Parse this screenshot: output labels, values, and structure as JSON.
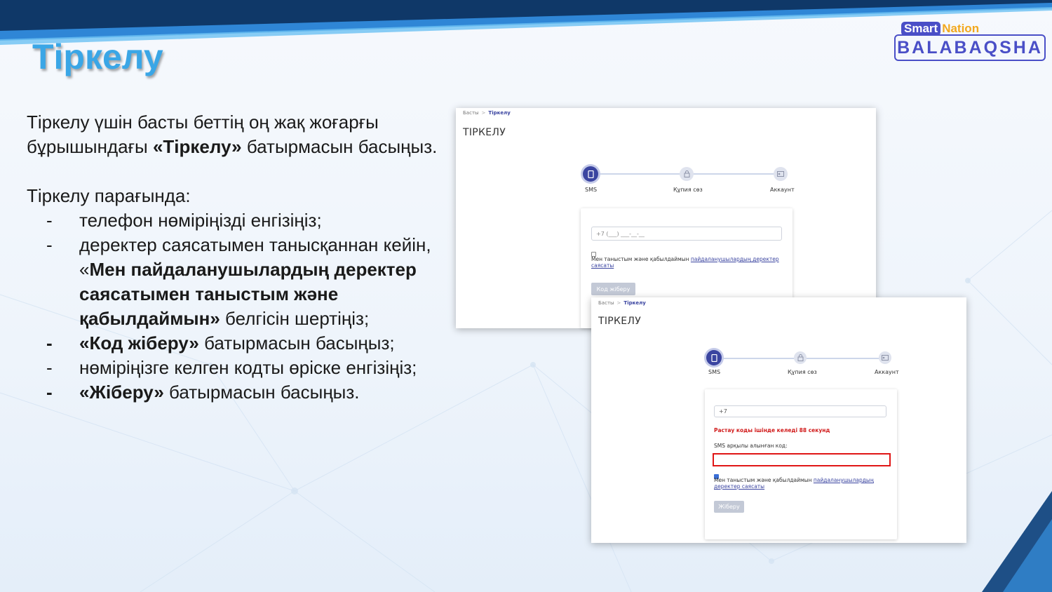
{
  "slide": {
    "title": "Тіркелу",
    "logo": {
      "smart": "Smart",
      "nation": "Nation",
      "brand": "BALABAQSHA"
    },
    "intro": {
      "part1": "Тіркелу үшін басты беттің оң жақ жоғарғы бұрышындағы ",
      "bold": "«Тіркелу»",
      "part2": " батырмасын басыңыз."
    },
    "list_heading": "Тіркелу парағында:",
    "items": [
      {
        "dash": "-",
        "text": "телефон нөміріңізді енгізіңіз;"
      },
      {
        "dash": "-",
        "pre": "деректер саясатымен танысқаннан кейін, «",
        "bold": "Мен пайдаланушылардың деректер саясатымен таныстым және қабылдаймын»",
        "post": " белгісін шертіңіз;"
      },
      {
        "dash": "-",
        "bold": "«Код жіберу»",
        "post": " батырмасын басыңыз;"
      },
      {
        "dash": "-",
        "text": "нөміріңізге келген кодты өріске енгізіңіз;"
      },
      {
        "dash": "-",
        "bold": "«Жіберу»",
        "post": " батырмасын басыңыз."
      }
    ]
  },
  "screen1": {
    "breadcrumb": {
      "home": "Басты",
      "sep": ">",
      "current": "Тіркелу"
    },
    "page_title": "ТІРКЕЛУ",
    "steps": [
      {
        "label": "SMS",
        "icon": "phone-icon",
        "active": true
      },
      {
        "label": "Құпия сөз",
        "icon": "lock-icon",
        "active": false
      },
      {
        "label": "Аккаунт",
        "icon": "id-card-icon",
        "active": false
      }
    ],
    "phone_placeholder": "+7 (___) ___-__-__",
    "consent_text": "Мен таныстым және қабылдаймын ",
    "consent_link": "пайдаланушылардың деректер саясаты",
    "submit_label": "Код жіберу"
  },
  "screen2": {
    "breadcrumb": {
      "home": "Басты",
      "sep": ">",
      "current": "Тіркелу"
    },
    "page_title": "ТІРКЕЛУ",
    "steps": [
      {
        "label": "SMS",
        "icon": "phone-icon",
        "active": true
      },
      {
        "label": "Құпия сөз",
        "icon": "lock-icon",
        "active": false
      },
      {
        "label": "Аккаунт",
        "icon": "id-card-icon",
        "active": false
      }
    ],
    "phone_value": "+7",
    "timer_text": "Растау коды ішінде келеді 88 секунд",
    "sms_label": "SMS арқылы алынған код:",
    "code_value": "",
    "consent_text": "Мен таныстым және қабылдаймын ",
    "consent_link": "пайдаланушылардың деректер саясаты",
    "submit_label": "Жіберу"
  },
  "colors": {
    "title": "#3aa6e6",
    "brand": "#4a4fc7",
    "accent": "#3a44a0",
    "error": "#e01616"
  }
}
